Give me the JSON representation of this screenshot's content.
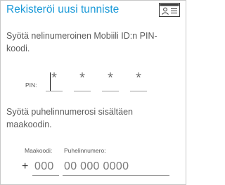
{
  "header": {
    "title": "Rekisteröi uusi tunniste",
    "icon": "id-card-icon",
    "accent_color": "#1c9ad8"
  },
  "pin_section": {
    "instruction": "Syötä nelinumeroinen Mobiili ID:n PIN-koodi.",
    "label": "PIN:",
    "digits": [
      "*",
      "*",
      "*",
      "*"
    ]
  },
  "phone_section": {
    "instruction": "Syötä puhelinnumerosi sisältäen maakoodin.",
    "country_code_label": "Maakoodi:",
    "phone_label": "Puhelinnumero:",
    "plus_sign": "+",
    "country_code_placeholder": "000",
    "phone_placeholder": "00 000 0000"
  }
}
